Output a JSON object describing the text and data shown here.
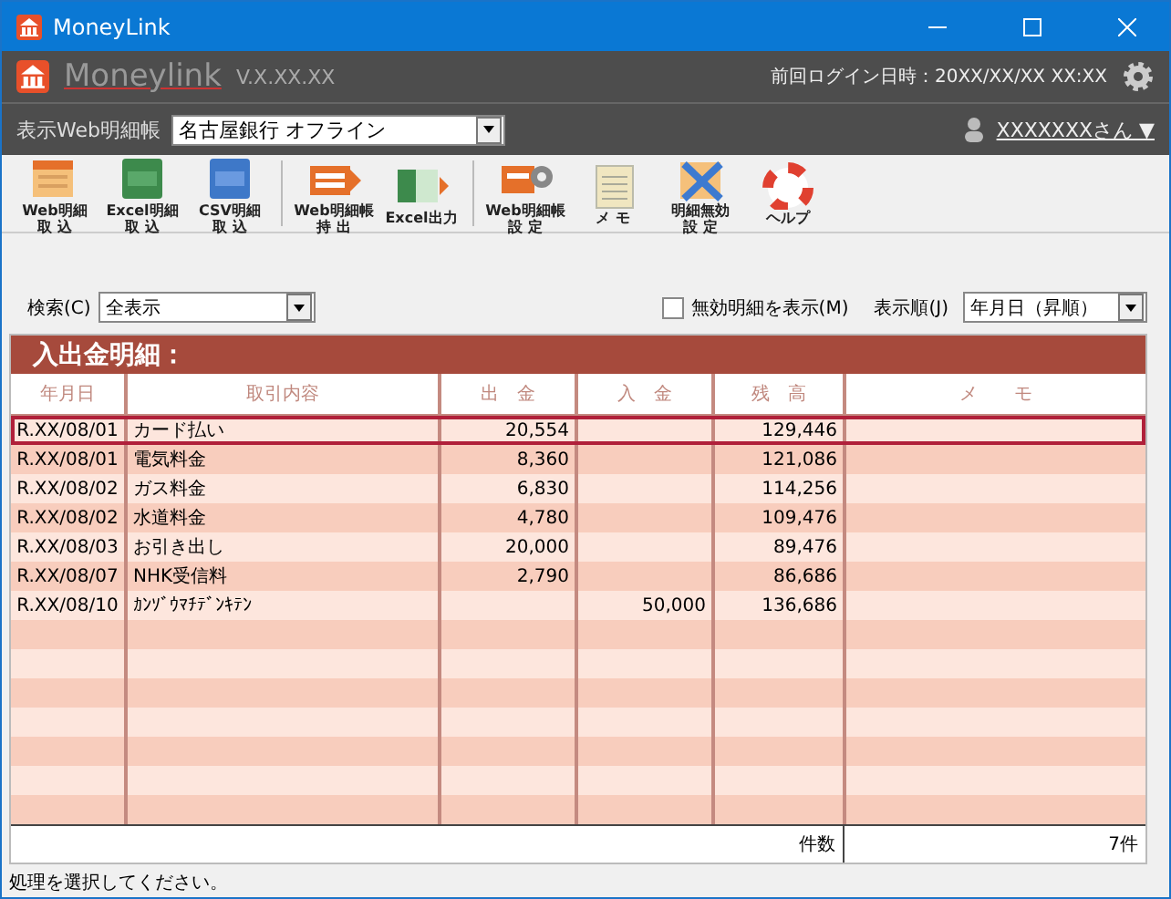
{
  "window": {
    "title": "MoneyLink"
  },
  "header": {
    "logo": "Moneylink",
    "version": "V.X.XX.XX",
    "last_login": "前回ログイン日時：20XX/XX/XX XX:XX",
    "account_label": "表示Web明細帳",
    "account_value": "名古屋銀行  オフライン",
    "user": "XXXXXXXさん ▼"
  },
  "toolbar_groups": [
    {
      "buttons": [
        {
          "kind": "web-import",
          "lines": [
            "Web明細",
            "取 込"
          ]
        },
        {
          "kind": "excel-import",
          "lines": [
            "Excel明細",
            "取 込"
          ]
        },
        {
          "kind": "csv-import",
          "lines": [
            "CSV明細",
            "取 込"
          ]
        }
      ]
    },
    {
      "buttons": [
        {
          "kind": "web-export",
          "lines": [
            "Web明細帳",
            "持 出"
          ]
        },
        {
          "kind": "excel-export",
          "lines": [
            "Excel出力"
          ]
        }
      ]
    },
    {
      "buttons": [
        {
          "kind": "web-settings",
          "lines": [
            "Web明細帳",
            "設 定"
          ]
        },
        {
          "kind": "memo",
          "lines": [
            "メ モ"
          ]
        },
        {
          "kind": "invalid",
          "lines": [
            "明細無効",
            "設 定"
          ]
        },
        {
          "kind": "help",
          "lines": [
            "ヘルプ"
          ]
        }
      ]
    }
  ],
  "filter": {
    "search_label": "検索(C)",
    "search_value": "全表示",
    "show_invalid": {
      "label": "無効明細を表示(M)",
      "checked": false
    },
    "sort_label": "表示順(J)",
    "sort_value": "年月日（昇順）"
  },
  "table": {
    "title": "入出金明細：",
    "columns": [
      "年月日",
      "取引内容",
      "出　金",
      "入　金",
      "残　高",
      "メ　　モ"
    ],
    "rows": [
      {
        "date": "R.XX/08/01",
        "desc": "カード払い",
        "out": "20,554",
        "in": "",
        "balance": "129,446",
        "selected": true
      },
      {
        "date": "R.XX/08/01",
        "desc": "電気料金",
        "out": "8,360",
        "in": "",
        "balance": "121,086",
        "selected": false
      },
      {
        "date": "R.XX/08/02",
        "desc": "ガス料金",
        "out": "6,830",
        "in": "",
        "balance": "114,256",
        "selected": false
      },
      {
        "date": "R.XX/08/02",
        "desc": "水道料金",
        "out": "4,780",
        "in": "",
        "balance": "109,476",
        "selected": false
      },
      {
        "date": "R.XX/08/03",
        "desc": "お引き出し",
        "out": "20,000",
        "in": "",
        "balance": "89,476",
        "selected": false
      },
      {
        "date": "R.XX/08/07",
        "desc": "NHK受信料",
        "out": "2,790",
        "in": "",
        "balance": "86,686",
        "selected": false
      },
      {
        "date": "R.XX/08/10",
        "desc": "ｶﾝｿﾞｳﾏﾁﾃﾞﾝｷﾃﾝ",
        "out": "",
        "in": "50,000",
        "balance": "136,686",
        "selected": false
      }
    ],
    "footer_label": "件数",
    "footer_count": "7件"
  },
  "status_bar": "処理を選択してください。"
}
